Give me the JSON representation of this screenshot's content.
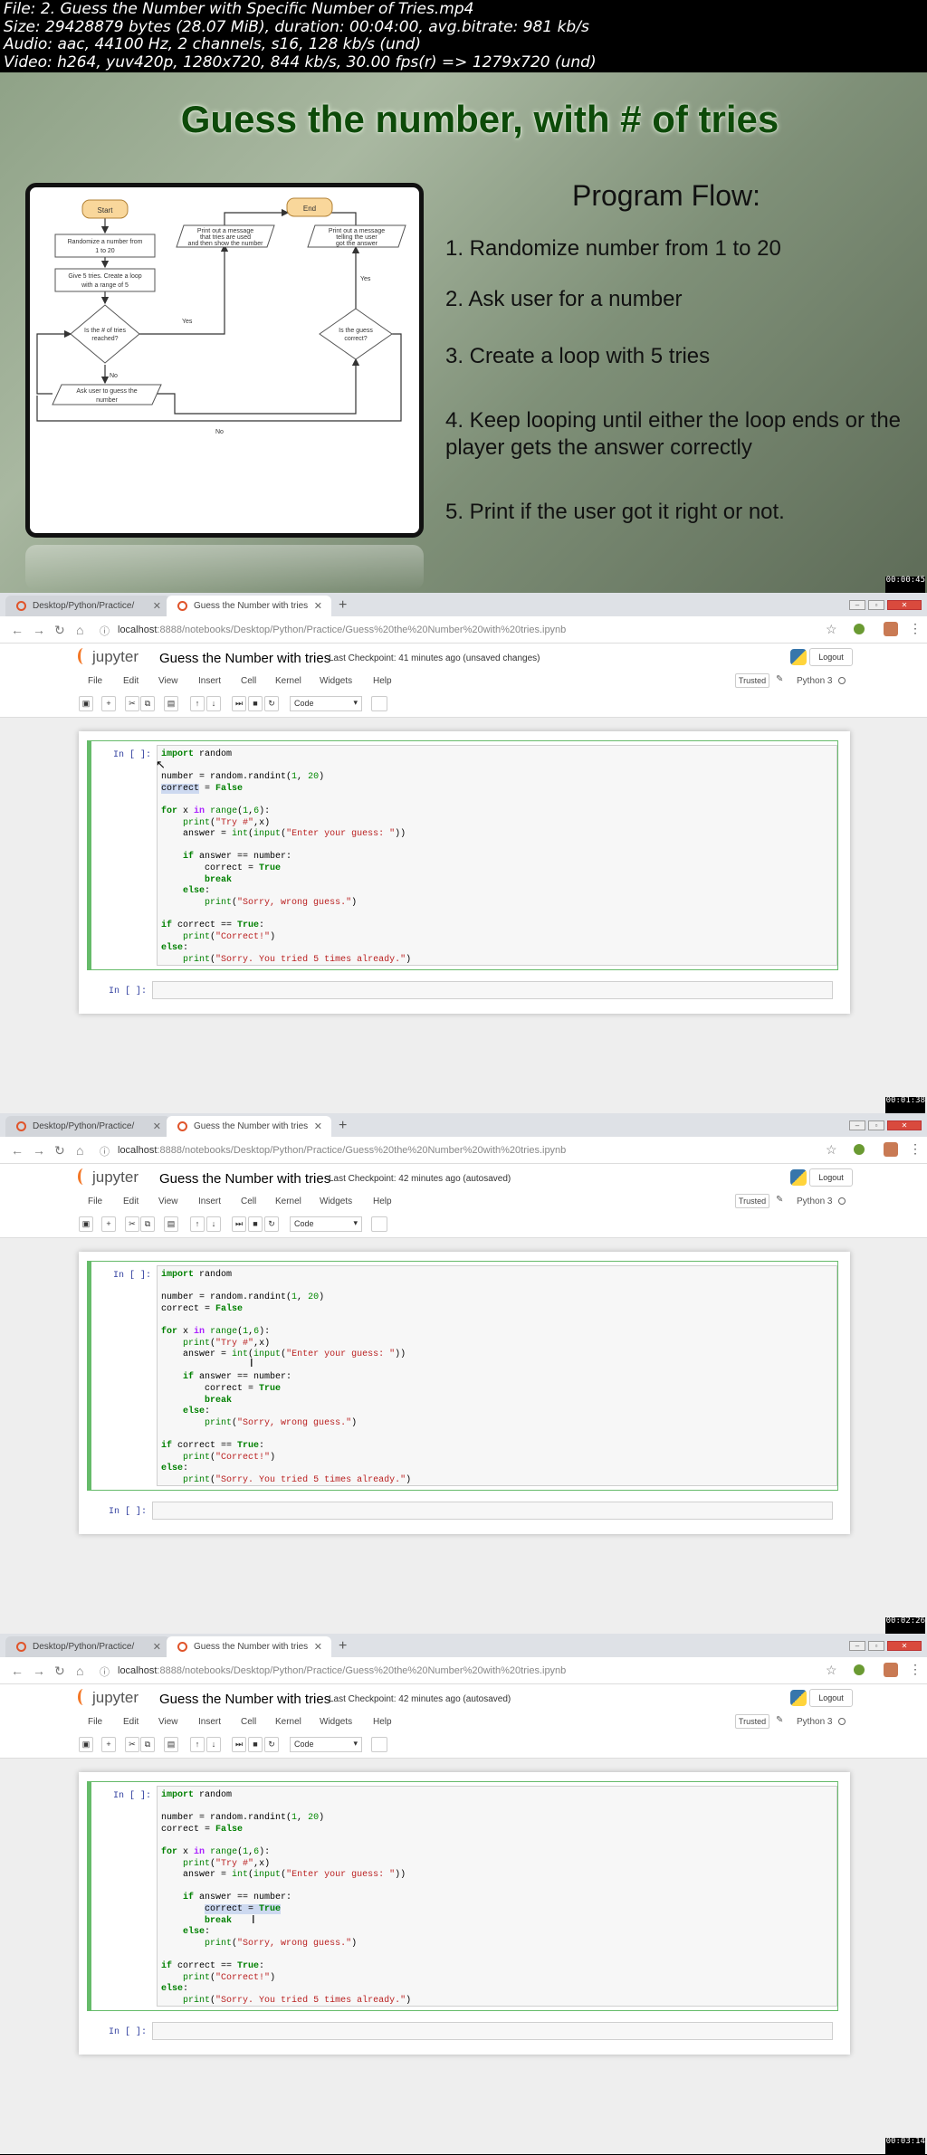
{
  "file_info": [
    "File: 2. Guess the Number with Specific Number of Tries.mp4",
    "Size: 29428879 bytes (28.07 MiB), duration: 00:04:00, avg.bitrate: 981 kb/s",
    "Audio: aac, 44100 Hz, 2 channels, s16, 128 kb/s (und)",
    "Video: h264, yuv420p, 1280x720, 844 kb/s, 30.00 fps(r) => 1279x720 (und)"
  ],
  "timestamps": [
    "00:00:45",
    "00:01:38",
    "00:02:26",
    "00:03:14"
  ],
  "slide": {
    "title": "Guess the number, with # of tries",
    "program_flow_title": "Program Flow:",
    "steps": [
      "1. Randomize number from 1 to 20",
      "2. Ask user for a number",
      "3. Create a loop with 5 tries",
      "4. Keep looping until either the loop ends or the player gets the answer correctly",
      "5. Print if the user got it right or not."
    ],
    "flowchart": {
      "start": "Start",
      "end": "End",
      "randomize": [
        "Randomize a number from",
        "1 to 20"
      ],
      "give_tries": [
        "Give 5 tries. Create a loop",
        "with a range of 5"
      ],
      "decision_tries": [
        "Is the # of tries",
        "reached?"
      ],
      "ask_user": [
        "Ask user to guess the",
        "number"
      ],
      "print_tries": [
        "Print out a message",
        "that tries are used",
        "and then show the number"
      ],
      "print_got": [
        "Print out a message",
        "telling the user",
        "got the answer"
      ],
      "decision_correct": [
        "Is the guess",
        "correct?"
      ],
      "yes1": "Yes",
      "yes2": "Yes",
      "no1": "No",
      "no2": "No"
    }
  },
  "browser": {
    "tab1": "Desktop/Python/Practice/",
    "tab2": "Guess the Number with tries",
    "url_host": "localhost",
    "url_path": ":8888/notebooks/Desktop/Python/Practice/Guess%20the%20Number%20with%20tries.ipynb",
    "jupyter": "jupyter",
    "notebook_title": "Guess the Number with tries",
    "logout": "Logout",
    "menu": [
      "File",
      "Edit",
      "View",
      "Insert",
      "Cell",
      "Kernel",
      "Widgets",
      "Help"
    ],
    "trusted": "Trusted",
    "kernel": "Python 3",
    "cell_type": "Code",
    "prompt": "In [ ]:"
  },
  "checkpoints": [
    "Last Checkpoint: 41 minutes ago (unsaved changes)",
    "Last Checkpoint: 42 minutes ago (autosaved)",
    "Last Checkpoint: 42 minutes ago (autosaved)"
  ]
}
